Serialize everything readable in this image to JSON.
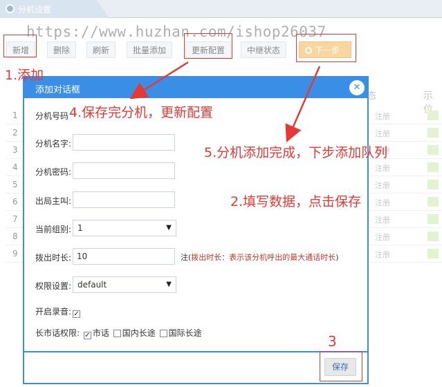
{
  "tab": {
    "title": "分机设置",
    "icon": "refresh-icon"
  },
  "watermark": "https://www.huzhan.com/ishop26037",
  "toolbar": {
    "buttons": [
      "新增",
      "删除",
      "刷新",
      "批量添加",
      "更新配置",
      "中继状态",
      "下一步"
    ]
  },
  "background_table": {
    "header_status": "态",
    "header_display": "示位",
    "rows": [
      {
        "num": "1",
        "status": "注册"
      },
      {
        "num": "2",
        "status": "注册"
      },
      {
        "num": "3",
        "status": "注册"
      },
      {
        "num": "4",
        "status": "注册"
      },
      {
        "num": "5",
        "status": "注册"
      },
      {
        "num": "6",
        "status": "注册"
      },
      {
        "num": "7",
        "status": "注册"
      },
      {
        "num": "8",
        "status": "注册"
      },
      {
        "num": "9",
        "status": "注册"
      }
    ]
  },
  "dialog": {
    "title": "添加对话框",
    "close_icon": "close-icon",
    "fields": {
      "ext_number_label": "分机号码",
      "ext_name_label": "分机名字:",
      "ext_password_label": "分机密码:",
      "caller_id_label": "出局主叫:",
      "group_label": "当前组别:",
      "group_value": "1",
      "dial_timeout_label": "拨出时长:",
      "dial_timeout_value": "10",
      "dial_timeout_note_prefix": "注(",
      "dial_timeout_note_text": "拨出时长：表示该分机呼出的最大通话时长",
      "dial_timeout_note_suffix": ")",
      "permission_label": "权限设置:",
      "permission_value": "default",
      "recording_label": "开启录音:",
      "long_distance_label": "长市话权限:",
      "opt_local": "市话",
      "opt_domestic": "国内长途",
      "opt_international": "国际长途"
    },
    "save_label": "保存"
  },
  "annotations": {
    "a1": "1.添加",
    "a2": "2.填写数据，点击保存",
    "a3": "3",
    "a4": "4.保存完分机，更新配置",
    "a5": "5.分机添加完成，下步添加队列"
  },
  "colors": {
    "accent": "#3b8ee6",
    "annotation": "#e53935",
    "next_button": "#f7d6a0"
  }
}
